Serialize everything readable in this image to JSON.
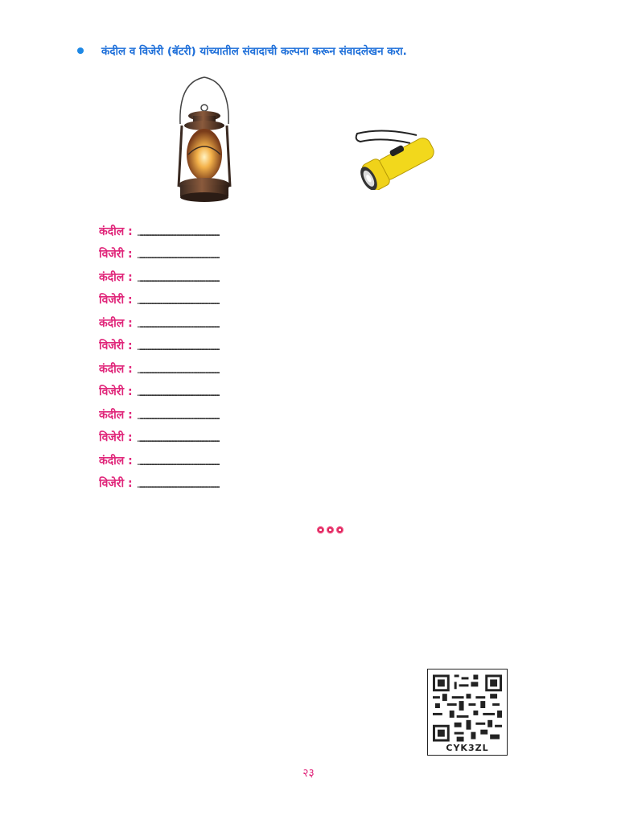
{
  "instruction": {
    "bullet_color": "#1e88e5",
    "text": "कंदील व विजेरी (बॅटरी) यांच्यातील संवादाची कल्पना करून संवादलेखन करा."
  },
  "images": {
    "lantern_icon": "lantern-icon",
    "flashlight_icon": "flashlight-icon"
  },
  "dialogue": [
    {
      "speaker": "कंदील :",
      "dots": "……………………………………………………………………………"
    },
    {
      "speaker": "विजेरी :",
      "dots": "……………………………………………………………………………"
    },
    {
      "speaker": "कंदील :",
      "dots": "……………………………………………………………………………"
    },
    {
      "speaker": "विजेरी :",
      "dots": "……………………………………………………………………………"
    },
    {
      "speaker": "कंदील :",
      "dots": "……………………………………………………………………………"
    },
    {
      "speaker": "विजेरी :",
      "dots": "……………………………………………………………………………"
    },
    {
      "speaker": "कंदील :",
      "dots": "……………………………………………………………………………"
    },
    {
      "speaker": "विजेरी :",
      "dots": "……………………………………………………………………………"
    },
    {
      "speaker": "कंदील :",
      "dots": "……………………………………………………………………………"
    },
    {
      "speaker": "विजेरी :",
      "dots": "……………………………………………………………………………"
    },
    {
      "speaker": "कंदील :",
      "dots": "……………………………………………………………………………"
    },
    {
      "speaker": "विजेरी :",
      "dots": "……………………………………………………………………………"
    }
  ],
  "qr": {
    "code": "CYK3ZL"
  },
  "page_number": "२३",
  "colors": {
    "heading": "#1e6fd9",
    "speaker": "#e0267a",
    "ornament": "#e0245e"
  }
}
